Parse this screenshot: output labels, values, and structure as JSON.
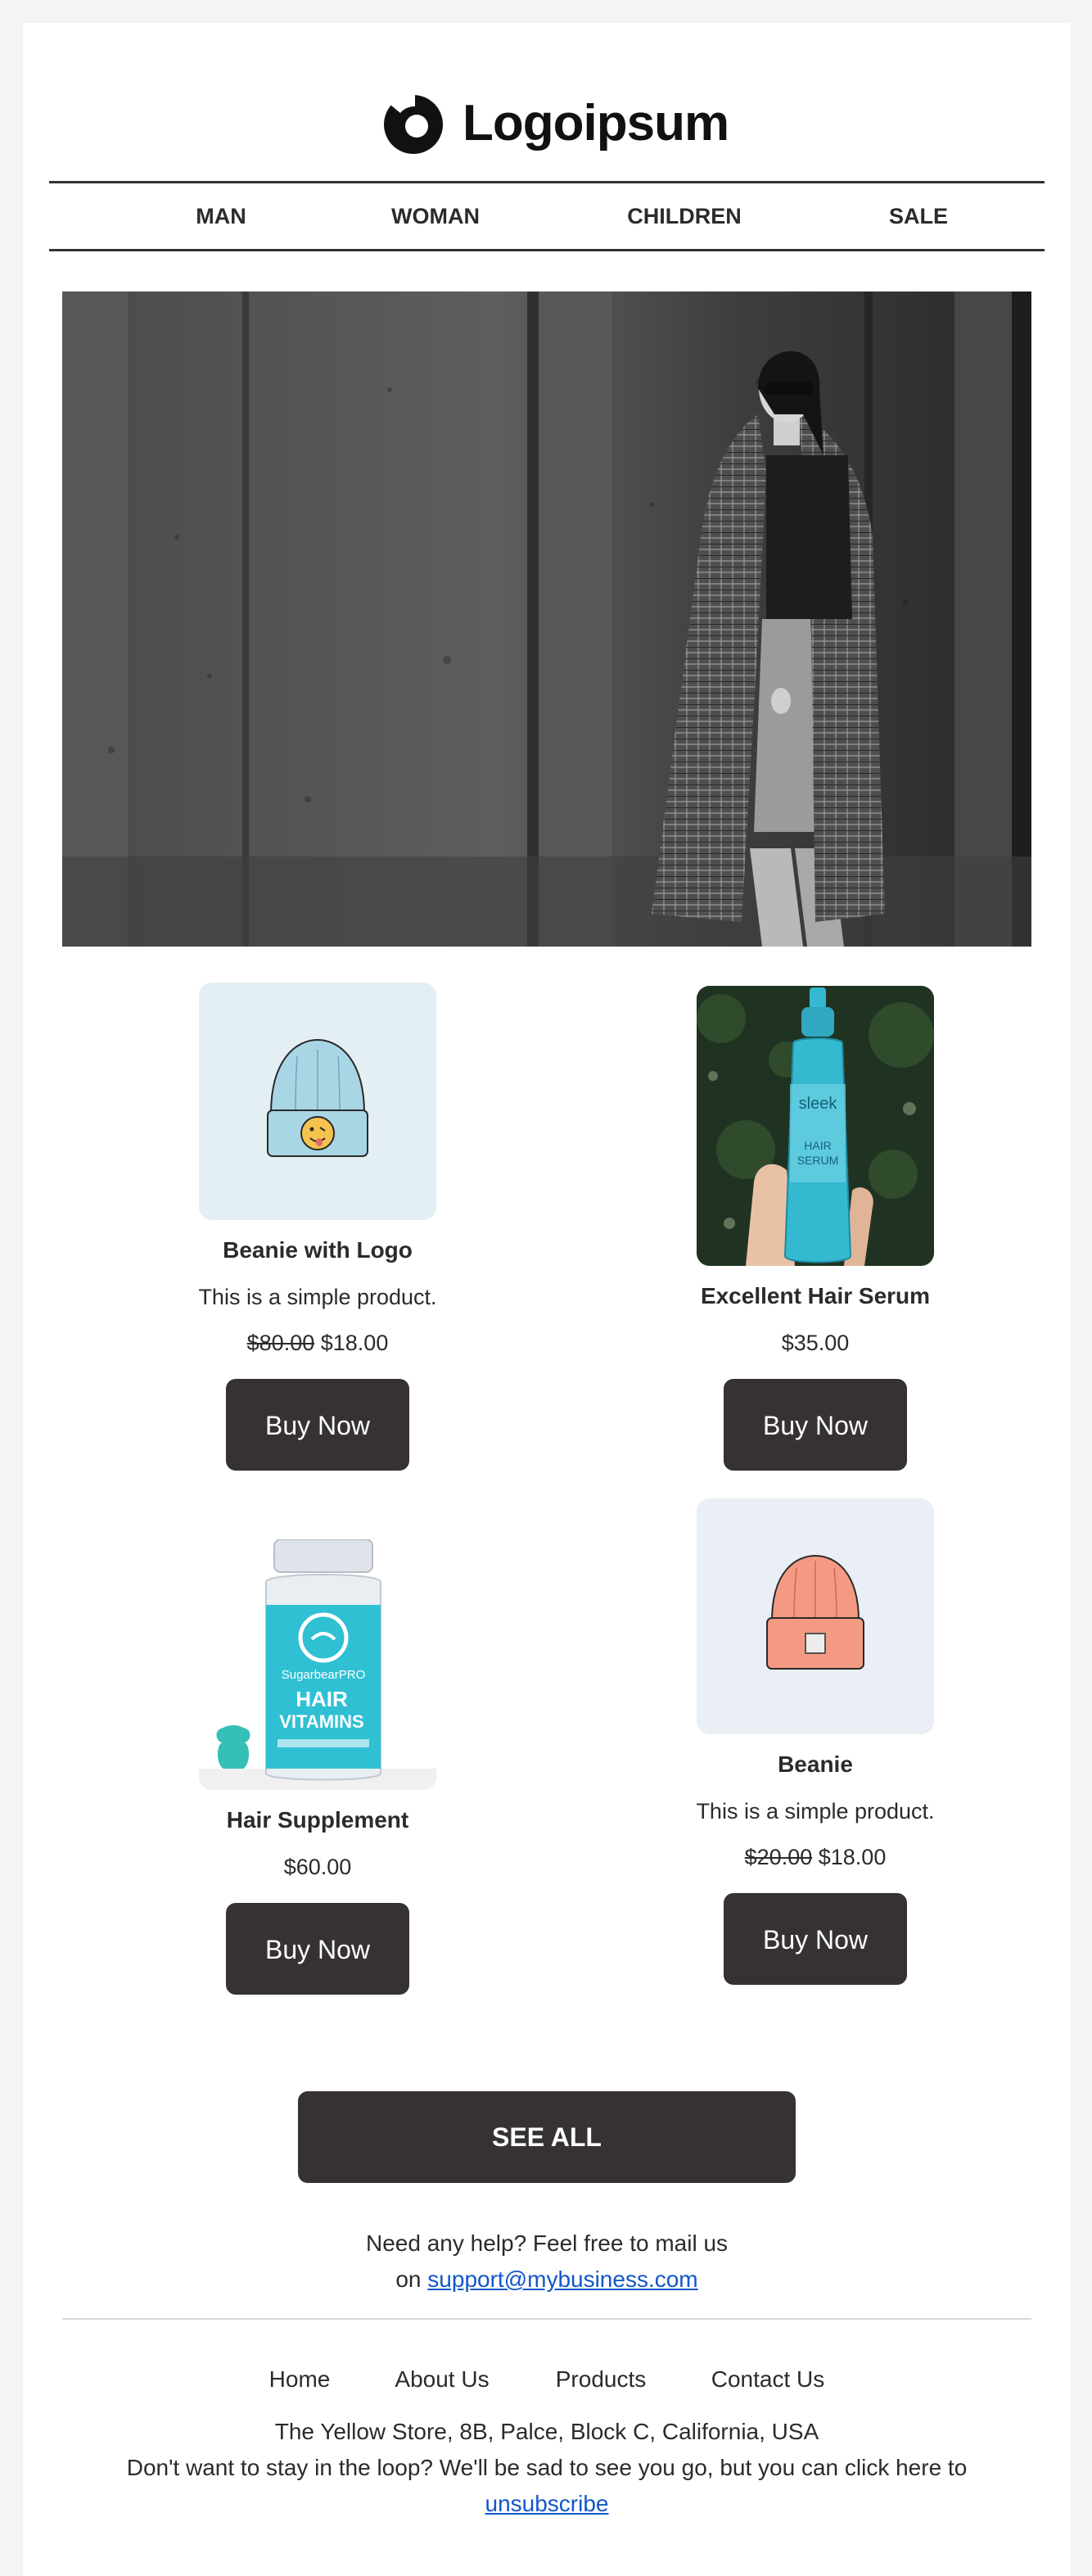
{
  "brand": {
    "name": "Logoipsum"
  },
  "nav": {
    "items": [
      "MAN",
      "WOMAN",
      "CHILDREN",
      "SALE"
    ]
  },
  "products": [
    {
      "name": "Beanie with Logo",
      "description": "This is a simple product.",
      "old_price": "$80.00",
      "price": "$18.00",
      "button": "Buy Now",
      "image": "blue-beanie-with-smiley-logo"
    },
    {
      "name": "Excellent Hair Serum",
      "description": "",
      "old_price": "",
      "price": "$35.00",
      "button": "Buy Now",
      "image": "hair-serum-bottle-in-hand"
    },
    {
      "name": "Hair Supplement",
      "description": "",
      "old_price": "",
      "price": "$60.00",
      "button": "Buy Now",
      "image": "hair-vitamins-jar"
    },
    {
      "name": "Beanie",
      "description": "This is a simple product.",
      "old_price": "$20.00",
      "price": "$18.00",
      "button": "Buy Now",
      "image": "orange-beanie"
    }
  ],
  "product_images": {
    "serum_label": [
      "sleek",
      "HAIR",
      "SERUM"
    ],
    "vitamins_label": [
      "SugarbearPRO",
      "HAIR",
      "VITAMINS"
    ]
  },
  "see_all": "SEE ALL",
  "help": {
    "line1": "Need any help? Feel free to mail us",
    "prefix": "on",
    "email": "support@mybusiness.com"
  },
  "footer": {
    "links": [
      "Home",
      "About Us",
      "Products",
      "Contact Us"
    ],
    "address": "The Yellow Store, 8B, Palce, Block C, California, USA",
    "unsubscribe_text": "Don't want to stay in the loop? We'll be sad to see you go, but you can click here to",
    "unsubscribe_link": "unsubscribe"
  },
  "colors": {
    "button": "#363231",
    "link": "#1257c8",
    "beanie_blue": "#a9d6e5",
    "beanie_orange": "#f59a82",
    "serum": "#35b9d1"
  }
}
